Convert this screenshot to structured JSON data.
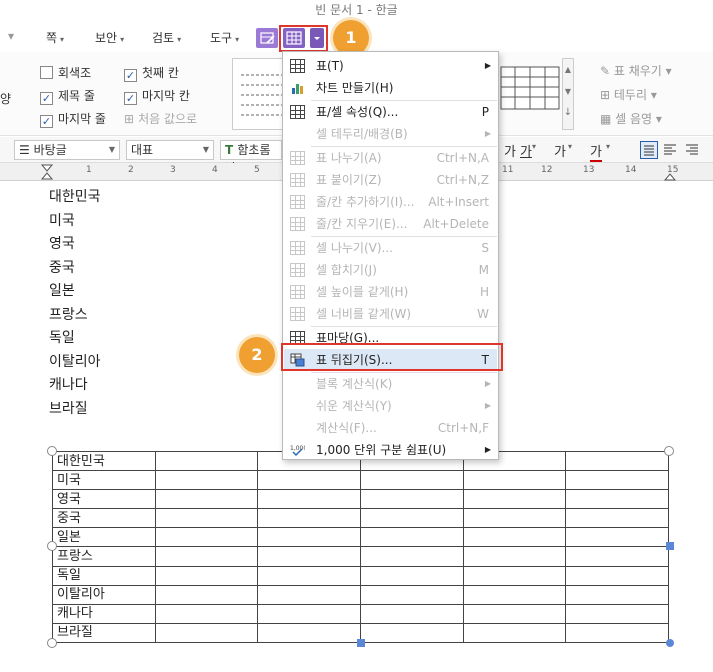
{
  "window": {
    "title": "빈 문서 1 - 한글"
  },
  "menubar": {
    "items": [
      {
        "label": "쪽"
      },
      {
        "label": "보안"
      },
      {
        "label": "검토"
      },
      {
        "label": "도구"
      }
    ]
  },
  "ribbon": {
    "checkboxes": [
      {
        "label": "회색조",
        "checked": false
      },
      {
        "label": "첫째 칸",
        "checked": true
      },
      {
        "label": "제목 줄",
        "checked": true
      },
      {
        "label": "마지막 칸",
        "checked": true
      },
      {
        "label": "마지막 줄",
        "checked": true
      },
      {
        "label": "처음 값으로",
        "checked": false
      }
    ],
    "left_cut_label": "양",
    "right_tools": {
      "fill": "표 채우기",
      "border": "테두리",
      "cell_fill": "셀 음영"
    }
  },
  "format_bar": {
    "style": "바탕글",
    "lang": "대표",
    "font": "함초롬바",
    "fmt_buttons": [
      "가",
      "가",
      "가",
      "가"
    ]
  },
  "ruler": {
    "ticks": [
      "1",
      "2",
      "3",
      "4",
      "5",
      "11",
      "12",
      "13",
      "14",
      "15"
    ]
  },
  "document": {
    "list": [
      "대한민국",
      "미국",
      "영국",
      "중국",
      "일본",
      "프랑스",
      "독일",
      "이탈리아",
      "캐나다",
      "브라질"
    ],
    "table_rows": [
      "대한민국",
      "미국",
      "영국",
      "중국",
      "일본",
      "프랑스",
      "독일",
      "이탈리아",
      "캐나다",
      "브라질"
    ]
  },
  "annotations": {
    "step1": "1",
    "step2": "2",
    "accent": "#e0352b",
    "badge_color": "#f0a030"
  },
  "table_menu": {
    "items": [
      {
        "label": "표(T)",
        "shortcut": "",
        "enabled": true,
        "submenu": true
      },
      {
        "label": "차트 만들기(H)",
        "shortcut": "",
        "enabled": true,
        "submenu": false
      },
      {
        "label": "표/셀 속성(Q)...",
        "shortcut": "P",
        "enabled": true,
        "submenu": false
      },
      {
        "label": "셀 테두리/배경(B)",
        "shortcut": "",
        "enabled": false,
        "submenu": true
      },
      {
        "label": "표 나누기(A)",
        "shortcut": "Ctrl+N,A",
        "enabled": false,
        "submenu": false
      },
      {
        "label": "표 붙이기(Z)",
        "shortcut": "Ctrl+N,Z",
        "enabled": false,
        "submenu": false
      },
      {
        "label": "줄/칸 추가하기(I)...",
        "shortcut": "Alt+Insert",
        "enabled": false,
        "submenu": false
      },
      {
        "label": "줄/칸 지우기(E)...",
        "shortcut": "Alt+Delete",
        "enabled": false,
        "submenu": false
      },
      {
        "label": "셀 나누기(V)...",
        "shortcut": "S",
        "enabled": false,
        "submenu": false
      },
      {
        "label": "셀 합치기(J)",
        "shortcut": "M",
        "enabled": false,
        "submenu": false
      },
      {
        "label": "셀 높이를 같게(H)",
        "shortcut": "H",
        "enabled": false,
        "submenu": false
      },
      {
        "label": "셀 너비를 같게(W)",
        "shortcut": "W",
        "enabled": false,
        "submenu": false
      },
      {
        "label": "표마당(G)...",
        "shortcut": "",
        "enabled": true,
        "submenu": false
      },
      {
        "label": "표 뒤집기(S)...",
        "shortcut": "T",
        "enabled": true,
        "submenu": false
      },
      {
        "label": "블록 계산식(K)",
        "shortcut": "",
        "enabled": false,
        "submenu": true
      },
      {
        "label": "쉬운 계산식(Y)",
        "shortcut": "",
        "enabled": false,
        "submenu": true
      },
      {
        "label": "계산식(F)...",
        "shortcut": "Ctrl+N,F",
        "enabled": false,
        "submenu": false
      },
      {
        "label": "1,000 단위 구분 쉼표(U)",
        "shortcut": "",
        "enabled": true,
        "submenu": true
      }
    ]
  }
}
